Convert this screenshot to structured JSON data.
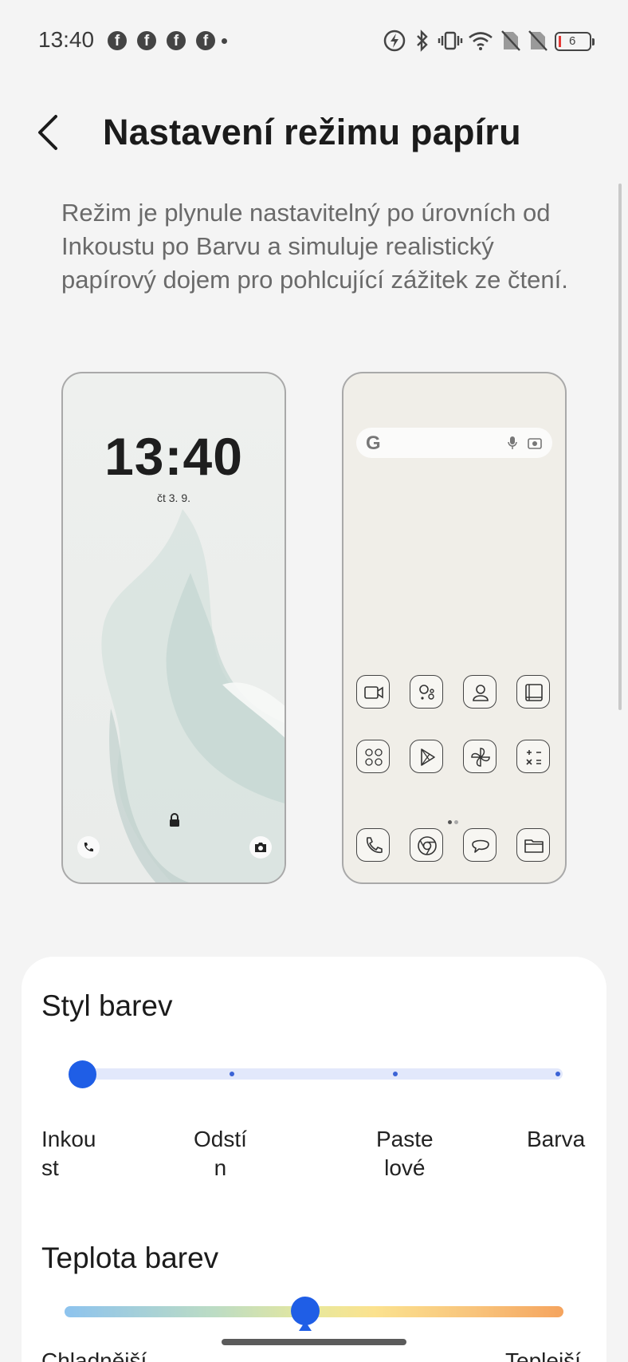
{
  "status_bar": {
    "time": "13:40",
    "notification_icons": [
      "facebook-icon",
      "facebook-icon",
      "facebook-icon",
      "facebook-icon"
    ],
    "system_icons": [
      "battery-saver-icon",
      "bluetooth-icon",
      "vibrate-icon",
      "wifi-icon",
      "no-sim-icon",
      "no-sim-icon"
    ],
    "battery_level": "6"
  },
  "header": {
    "title": "Nastavení režimu papíru"
  },
  "description": "Režim je plynule nastavitelný po úrovních od Inkoustu po Barvu a simuluje realistický papírový dojem pro pohlcující zážitek ze čtení.",
  "preview": {
    "lock_screen": {
      "time": "13:40",
      "date": "čt 3. 9."
    },
    "home_screen": {
      "search_logo": "G",
      "apps_row1": [
        "video-camera-icon",
        "assistant-icon",
        "contacts-icon",
        "gallery-icon"
      ],
      "apps_row2": [
        "folder-icon",
        "play-store-icon",
        "pinwheel-icon",
        "calculator-icon"
      ],
      "dock": [
        "phone-icon",
        "chrome-icon",
        "messages-icon",
        "files-icon"
      ]
    }
  },
  "color_style": {
    "title": "Styl barev",
    "labels": [
      "Inkou\nst",
      "Odstí\nn",
      "Paste\nlové",
      "Barva"
    ],
    "selected_index": 0
  },
  "color_temperature": {
    "title": "Teplota barev",
    "min_label": "Chladnější",
    "max_label": "Teplejší",
    "value_fraction": 0.48
  },
  "colors": {
    "accent": "#1f5ee6",
    "card": "#ffffff",
    "background": "#f4f4f4"
  }
}
